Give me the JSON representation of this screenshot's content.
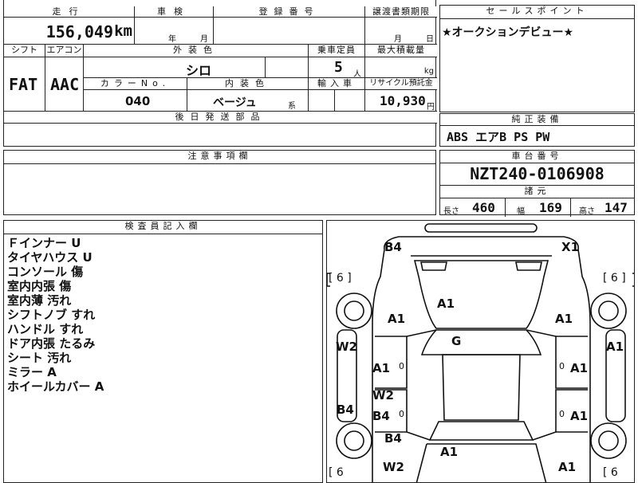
{
  "top_row": {
    "mileage_label": "走行",
    "mileage_value": "156,049",
    "mileage_unit": "km",
    "inspection_label": "車検",
    "inspection_year": "年",
    "inspection_month": "月",
    "registration_label": "登録番号",
    "transfer_label": "譲渡書類期限",
    "transfer_month": "月",
    "transfer_day": "日"
  },
  "row2": {
    "shift_label": "シフト",
    "shift_value": "FAT",
    "ac_label": "エアコン",
    "ac_value": "AAC",
    "exterior_color_label": "外装色",
    "exterior_color_value": "シロ",
    "capacity_label": "乗車定員",
    "capacity_value": "5",
    "capacity_unit": "人",
    "load_label": "最大積載量",
    "load_unit": "kg",
    "color_no_label": "カラーNo.",
    "color_no_value": "040",
    "interior_label": "内装色",
    "interior_value": "ベージュ",
    "interior_suffix": "系",
    "import_label": "輸入車",
    "recycle_label": "リサイクル預託金",
    "recycle_value": "10,930",
    "recycle_unit": "円",
    "later_parts_label": "後日発送部品"
  },
  "sales_point": {
    "label": "セールスポイント",
    "text": "★オークションデビュー★"
  },
  "genuine_equipment": {
    "label": "純正装備",
    "value": "ABS エアB PS PW"
  },
  "caution": {
    "label": "注意事項欄"
  },
  "chassis": {
    "label": "車台番号",
    "value": "NZT240-0106908",
    "spec_label": "諸元",
    "length_label": "長さ",
    "length_value": "460",
    "width_label": "幅",
    "width_value": "169",
    "height_label": "高さ",
    "height_value": "147"
  },
  "inspector": {
    "label": "検査員記入欄",
    "notes": [
      "Ｆインナー U",
      "タイヤハウス U",
      "コンソール 傷",
      "室内内張 傷",
      "室内薄 汚れ",
      "シフトノブ すれ",
      "ハンドル すれ",
      "ドア内張 たるみ",
      "シート 汚れ",
      "ミラー A",
      "ホイールカバー A"
    ]
  },
  "damage_map": {
    "tire_marks": [
      "[ 6 ]",
      "[ 6 ]",
      "[ 6",
      "[ 6"
    ],
    "codes": {
      "front_left": "B4",
      "front_right": "X1",
      "hood": "A1",
      "fender_left": "A1",
      "fender_right": "A1",
      "windshield": "G",
      "left_side_panel": "W2",
      "right_side_panel": "A1",
      "front_door_left": "A1",
      "front_door_right": "A1",
      "left_rocker": "B4",
      "rear_door_left_w": "W2",
      "rear_door_left_b": "B4",
      "rear_door_right": "A1",
      "rear_quarter_left": "B4",
      "trunk": "A1",
      "rear_left": "W2",
      "rear_right": "A1"
    },
    "small_zero": "0"
  }
}
